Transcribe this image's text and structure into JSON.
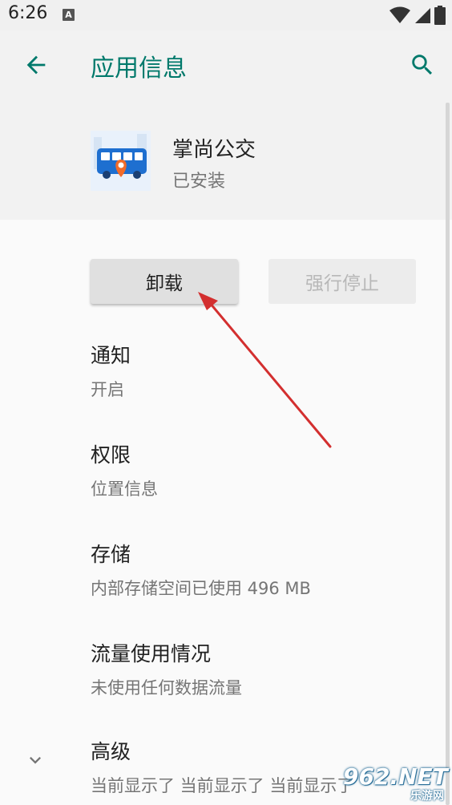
{
  "status_bar": {
    "time": "6:26",
    "notif_letter": "A",
    "icons": [
      "wifi-icon",
      "cellular-signal-icon",
      "battery-icon"
    ]
  },
  "app_bar": {
    "title": "应用信息",
    "back_icon": "arrow-left-icon",
    "search_icon": "search-icon",
    "accent_color": "#00796b"
  },
  "app_header": {
    "name": "掌尚公交",
    "status": "已安装",
    "icon": "bus-location-icon"
  },
  "buttons": {
    "uninstall": "卸载",
    "force_stop": "强行停止",
    "force_stop_enabled": false
  },
  "settings": [
    {
      "title": "通知",
      "summary": "开启"
    },
    {
      "title": "权限",
      "summary": "位置信息"
    },
    {
      "title": "存储",
      "summary": "内部存储空间已使用 496 MB"
    },
    {
      "title": "流量使用情况",
      "summary": "未使用任何数据流量"
    },
    {
      "title": "高级",
      "summary": "当前显示了 当前显示了 当前显示了"
    }
  ],
  "annotation": {
    "arrow_color": "#d32f2f"
  },
  "watermark": {
    "brand": "962.NET",
    "subtitle": "乐游网"
  }
}
